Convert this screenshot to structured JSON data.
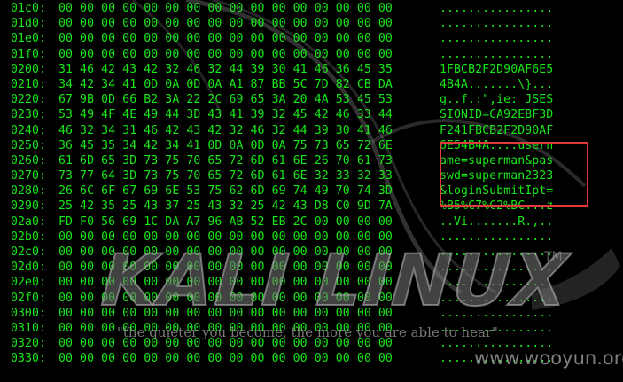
{
  "rows": [
    {
      "offset": "01c0:",
      "hex": "00 00 00 00 00 00 00 00 00 00 00 00 00 00 00 00",
      "ascii": "................"
    },
    {
      "offset": "01d0:",
      "hex": "00 00 00 00 00 00 00 00 00 00 00 00 00 00 00 00",
      "ascii": "................"
    },
    {
      "offset": "01e0:",
      "hex": "00 00 00 00 00 00 00 00 00 00 00 00 00 00 00 00",
      "ascii": "................"
    },
    {
      "offset": "01f0:",
      "hex": "00 00 00 00 00 00 00 00 00 00 00 00 00 00 00 00",
      "ascii": "................"
    },
    {
      "offset": "0200:",
      "hex": "31 46 42 43 42 32 46 32 44 39 30 41 46 36 45 35",
      "ascii": "1FBCB2F2D90AF6E5"
    },
    {
      "offset": "0210:",
      "hex": "34 42 34 41 0D 0A 0D 0A A1 87 BB 5C 7D 82 CB DA",
      "ascii": "4B4A.......\\}..."
    },
    {
      "offset": "0220:",
      "hex": "67 9B 0D 66 B2 3A 22 2C 69 65 3A 20 4A 53 45 53",
      "ascii": "g..f.:\",ie: JSES"
    },
    {
      "offset": "0230:",
      "hex": "53 49 4F 4E 49 44 3D 43 41 39 32 45 42 46 33 44",
      "ascii": "SIONID=CA92EBF3D"
    },
    {
      "offset": "0240:",
      "hex": "46 32 34 31 46 42 43 42 32 46 32 44 39 30 41 46",
      "ascii": "F241FBCB2F2D90AF"
    },
    {
      "offset": "0250:",
      "hex": "36 45 35 34 42 34 41 0D 0A 0D 0A 75 73 65 72 6E",
      "ascii": "6E54B4A....usern"
    },
    {
      "offset": "0260:",
      "hex": "61 6D 65 3D 73 75 70 65 72 6D 61 6E 26 70 61 73",
      "ascii": "ame=superman&pas"
    },
    {
      "offset": "0270:",
      "hex": "73 77 64 3D 73 75 70 65 72 6D 61 6E 32 33 32 33",
      "ascii": "swd=superman2323"
    },
    {
      "offset": "0280:",
      "hex": "26 6C 6F 67 69 6E 53 75 62 6D 69 74 49 70 74 3D",
      "ascii": "&loginSubmitIpt="
    },
    {
      "offset": "0290:",
      "hex": "25 42 35 25 43 37 25 43 32 25 42 43 D8 C0 9D 7A",
      "ascii": "%B5%C7%C2%BC...z"
    },
    {
      "offset": "02a0:",
      "hex": "FD F0 56 69 1C DA A7 96 AB 52 EB 2C 00 00 00 00",
      "ascii": "..Vi.......R.,.."
    },
    {
      "offset": "02b0:",
      "hex": "00 00 00 00 00 00 00 00 00 00 00 00 00 00 00 00",
      "ascii": "................"
    },
    {
      "offset": "02c0:",
      "hex": "00 00 00 00 00 00 00 00 00 00 00 00 00 00 00 00",
      "ascii": "................"
    },
    {
      "offset": "02d0:",
      "hex": "00 00 00 00 00 00 00 00 00 00 00 00 00 00 00 00",
      "ascii": "................"
    },
    {
      "offset": "02e0:",
      "hex": "00 00 00 00 00 00 00 00 00 00 00 00 00 00 00 00",
      "ascii": "................"
    },
    {
      "offset": "02f0:",
      "hex": "00 00 00 00 00 00 00 00 00 00 00 00 00 00 00 00",
      "ascii": "................"
    },
    {
      "offset": "0300:",
      "hex": "00 00 00 00 00 00 00 00 00 00 00 00 00 00 00 00",
      "ascii": "................"
    },
    {
      "offset": "0310:",
      "hex": "00 00 00 00 00 00 00 00 00 00 00 00 00 00 00 00",
      "ascii": "................"
    },
    {
      "offset": "0320:",
      "hex": "00 00 00 00 00 00 00 00 00 00 00 00 00 00 00 00",
      "ascii": "................"
    },
    {
      "offset": "0330:",
      "hex": "00 00 00 00 00 00 00 00 00 00 00 00 00 00 00 00",
      "ascii": "................"
    }
  ],
  "watermark": {
    "logo_text": "KALI LINUX",
    "trademark": "TM",
    "tagline": "\"the quieter you become, the more you are able to hear\"",
    "site": "www.wooyun.org"
  },
  "colors": {
    "text": "#19e619",
    "background": "#000000",
    "highlight_border": "#e03a3a"
  },
  "highlight_note_rows": [
    "0250:",
    "0260:",
    "0270:",
    "0280:"
  ]
}
